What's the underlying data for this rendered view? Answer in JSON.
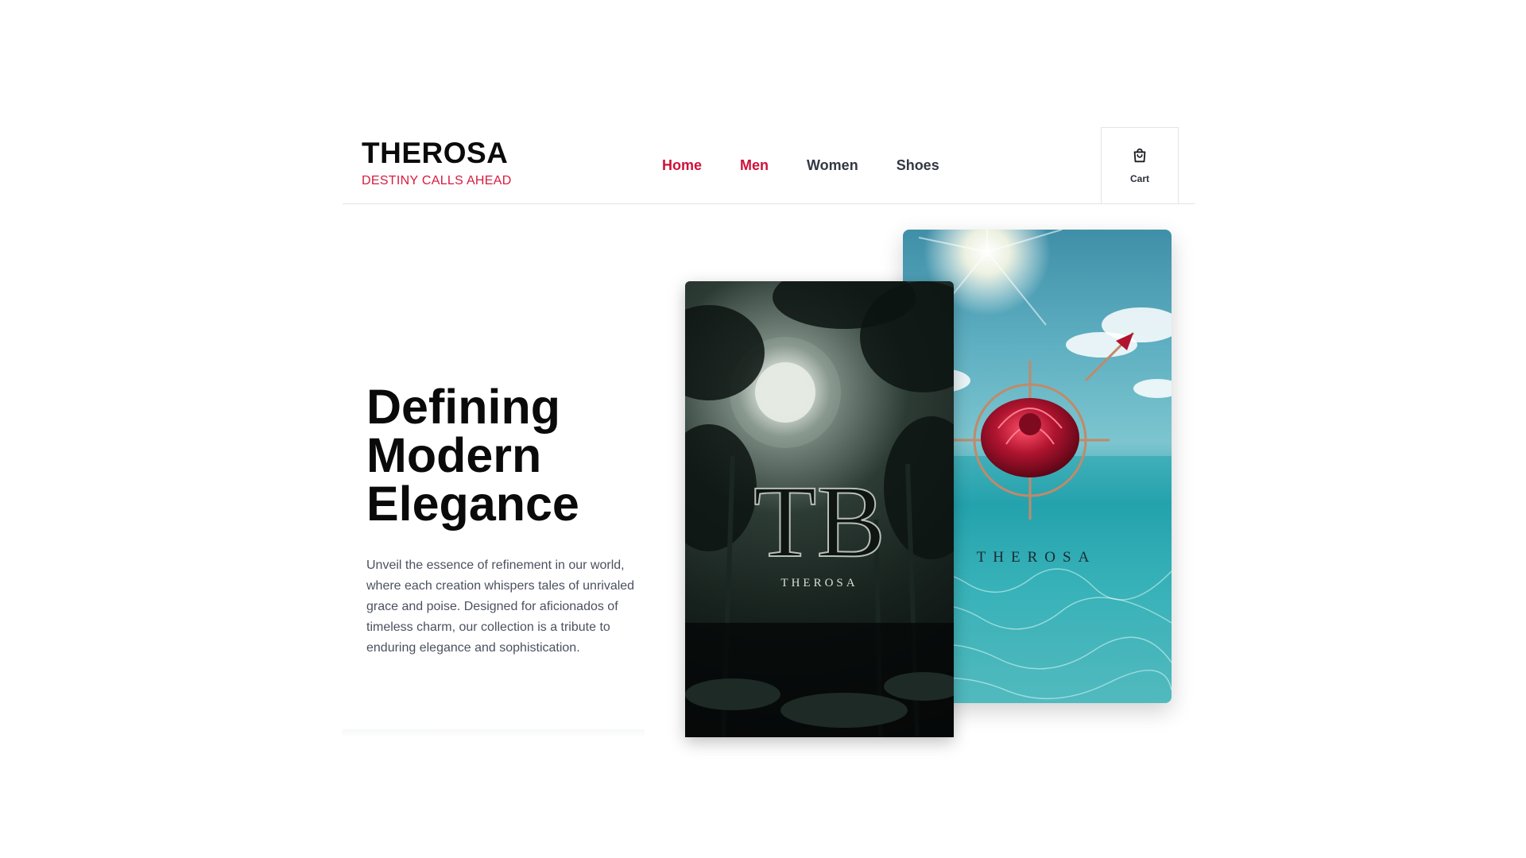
{
  "brand": {
    "name": "THEROSA",
    "tagline": "DESTINY CALLS AHEAD"
  },
  "nav": [
    {
      "label": "Home",
      "active": true
    },
    {
      "label": "Men",
      "active": true
    },
    {
      "label": "Women",
      "active": false
    },
    {
      "label": "Shoes",
      "active": false
    }
  ],
  "cart": {
    "label": "Cart",
    "icon": "shopping-bag-icon"
  },
  "hero": {
    "title_lines": [
      "Defining",
      "Modern",
      "Elegance"
    ],
    "description": "Unveil the essence of refinement in our world, where each creation whispers tales of unrivaled grace and poise. Designed for aficionados of timeless charm, our collection is a tribute to enduring elegance and sophistication."
  },
  "cards": {
    "left": {
      "caption": "THEROSA",
      "monogram": "TB"
    },
    "right": {
      "caption": "THEROSA"
    }
  },
  "colors": {
    "accent": "#d0103a",
    "nav_text": "#333844",
    "text_muted": "#4b5160"
  }
}
